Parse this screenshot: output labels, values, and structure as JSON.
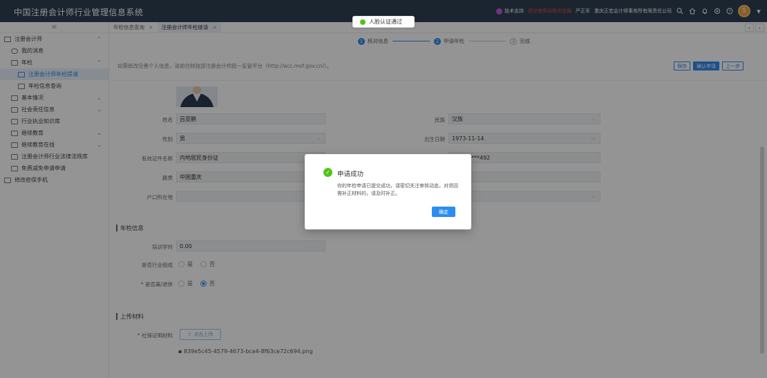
{
  "app": {
    "title": "中国注册会计师行业管理信息系统"
  },
  "topbar": {
    "tech_support": "技术支持",
    "tip": "建议使用谷歌浏览器",
    "user": "严正军",
    "org": "重庆正宏会计师事务所有限责任公司",
    "avatar_text": "S"
  },
  "toast": {
    "text": "人脸认证通过"
  },
  "sidebar": {
    "collapse_icon": "≡",
    "items": [
      {
        "label": "注册会计师"
      },
      {
        "label": "我的消息"
      },
      {
        "label": "年检"
      },
      {
        "label": "注册会计师年检提请"
      },
      {
        "label": "年检信息查询"
      },
      {
        "label": "基本情况"
      },
      {
        "label": "社会责任信息"
      },
      {
        "label": "行业执业知识库"
      },
      {
        "label": "继续教育"
      },
      {
        "label": "继续教育在线"
      },
      {
        "label": "注册会计师行业法律法规库"
      },
      {
        "label": "免费减免申请申请"
      },
      {
        "label": "修改密保手机"
      }
    ]
  },
  "tabs": [
    {
      "label": "年检信息查询"
    },
    {
      "label": "注册会计师年检提请"
    }
  ],
  "steps": [
    {
      "num": "1",
      "label": "核对信息"
    },
    {
      "num": "2",
      "label": "申请年检"
    },
    {
      "num": "3",
      "label": "完成"
    }
  ],
  "notice": "如需修改完善个人信息，请前往财政部注册会计师统一监管平台（http://acc.mof.gov.cn/）。",
  "buttons": {
    "save": "保存",
    "confirm": "确认申请",
    "prev": "上一步"
  },
  "form": {
    "name_label": "姓名",
    "name_value": "吕亚鹏",
    "ethnic_label": "民族",
    "ethnic_value": "汉族",
    "gender_label": "性别",
    "gender_value": "男",
    "birth_label": "出生日期",
    "birth_value": "1973-11-14",
    "idtype_label": "有效证件名称",
    "idtype_value": "内地居民身份证",
    "idno_value": "**********492",
    "origin_label": "籍贯",
    "origin_value": "中国重庆",
    "hukou_label": "户口所在地",
    "hukou_value": ""
  },
  "annual": {
    "section": "年检信息",
    "hours_label": "培训学时",
    "hours_value": "0.00",
    "leader_label": "是否行业组成",
    "yes": "是",
    "no": "否",
    "retired_label": "是否离/退休"
  },
  "upload": {
    "section": "上传材料",
    "field_label": "社保证明材料",
    "button": "点击上传",
    "file": "839e5c45-4579-4673-bca4-8f63ce72c694.png"
  },
  "modal": {
    "title": "申请成功",
    "text": "你的年检申请已提交成功，请密切关注审核动态，对退回需补正材料的，请及时补正。",
    "ok": "确定"
  }
}
